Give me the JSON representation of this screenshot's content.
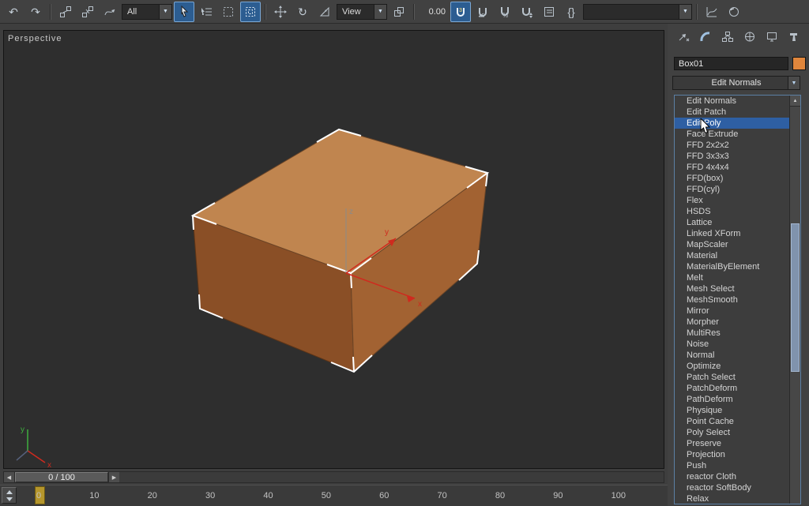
{
  "toolbar": {
    "selection_filter_value": "All",
    "coord_system_value": "View",
    "snap_value": "0.00",
    "named_sets_value": ""
  },
  "icons": {
    "undo": "↶",
    "redo": "↷",
    "rotate": "↻",
    "dropdown_arrow": "▼",
    "scroll_up_arrow": "▲",
    "slider_prev": "◀",
    "slider_next": "▶",
    "braces": "{}",
    "snap_3": "3",
    "snap_percent": "%"
  },
  "viewport": {
    "label": "Perspective",
    "axis": {
      "x": "x",
      "y": "y",
      "z": "z"
    },
    "world_axis": {
      "x": "x",
      "y": "y"
    }
  },
  "time_slider": {
    "value": "0 / 100"
  },
  "track_bar": {
    "ticks": [
      "0",
      "10",
      "20",
      "30",
      "40",
      "50",
      "60",
      "70",
      "80",
      "90",
      "100"
    ]
  },
  "command_panel": {
    "object_name": "Box01",
    "modifier_selected": "Edit Normals",
    "selected_modifier": "Edit Poly",
    "modifier_list": [
      "Edit Normals",
      "Edit Patch",
      "Edit Poly",
      "Face Extrude",
      "FFD 2x2x2",
      "FFD 3x3x3",
      "FFD 4x4x4",
      "FFD(box)",
      "FFD(cyl)",
      "Flex",
      "HSDS",
      "Lattice",
      "Linked XForm",
      "MapScaler",
      "Material",
      "MaterialByElement",
      "Melt",
      "Mesh Select",
      "MeshSmooth",
      "Mirror",
      "Morpher",
      "MultiRes",
      "Noise",
      "Normal",
      "Optimize",
      "Patch Select",
      "PatchDeform",
      "PathDeform",
      "Physique",
      "Point Cache",
      "Poly Select",
      "Preserve",
      "Projection",
      "Push",
      "reactor Cloth",
      "reactor SoftBody",
      "Relax"
    ]
  },
  "colors": {
    "accent_blue": "#2e5fa3",
    "object_color_swatch": "#e0863c",
    "box_top": "#c0854f",
    "box_left": "#8a4f26",
    "box_right": "#a26232",
    "axis_x": "#cf2a1e",
    "axis_y_world": "#3fae3f"
  }
}
